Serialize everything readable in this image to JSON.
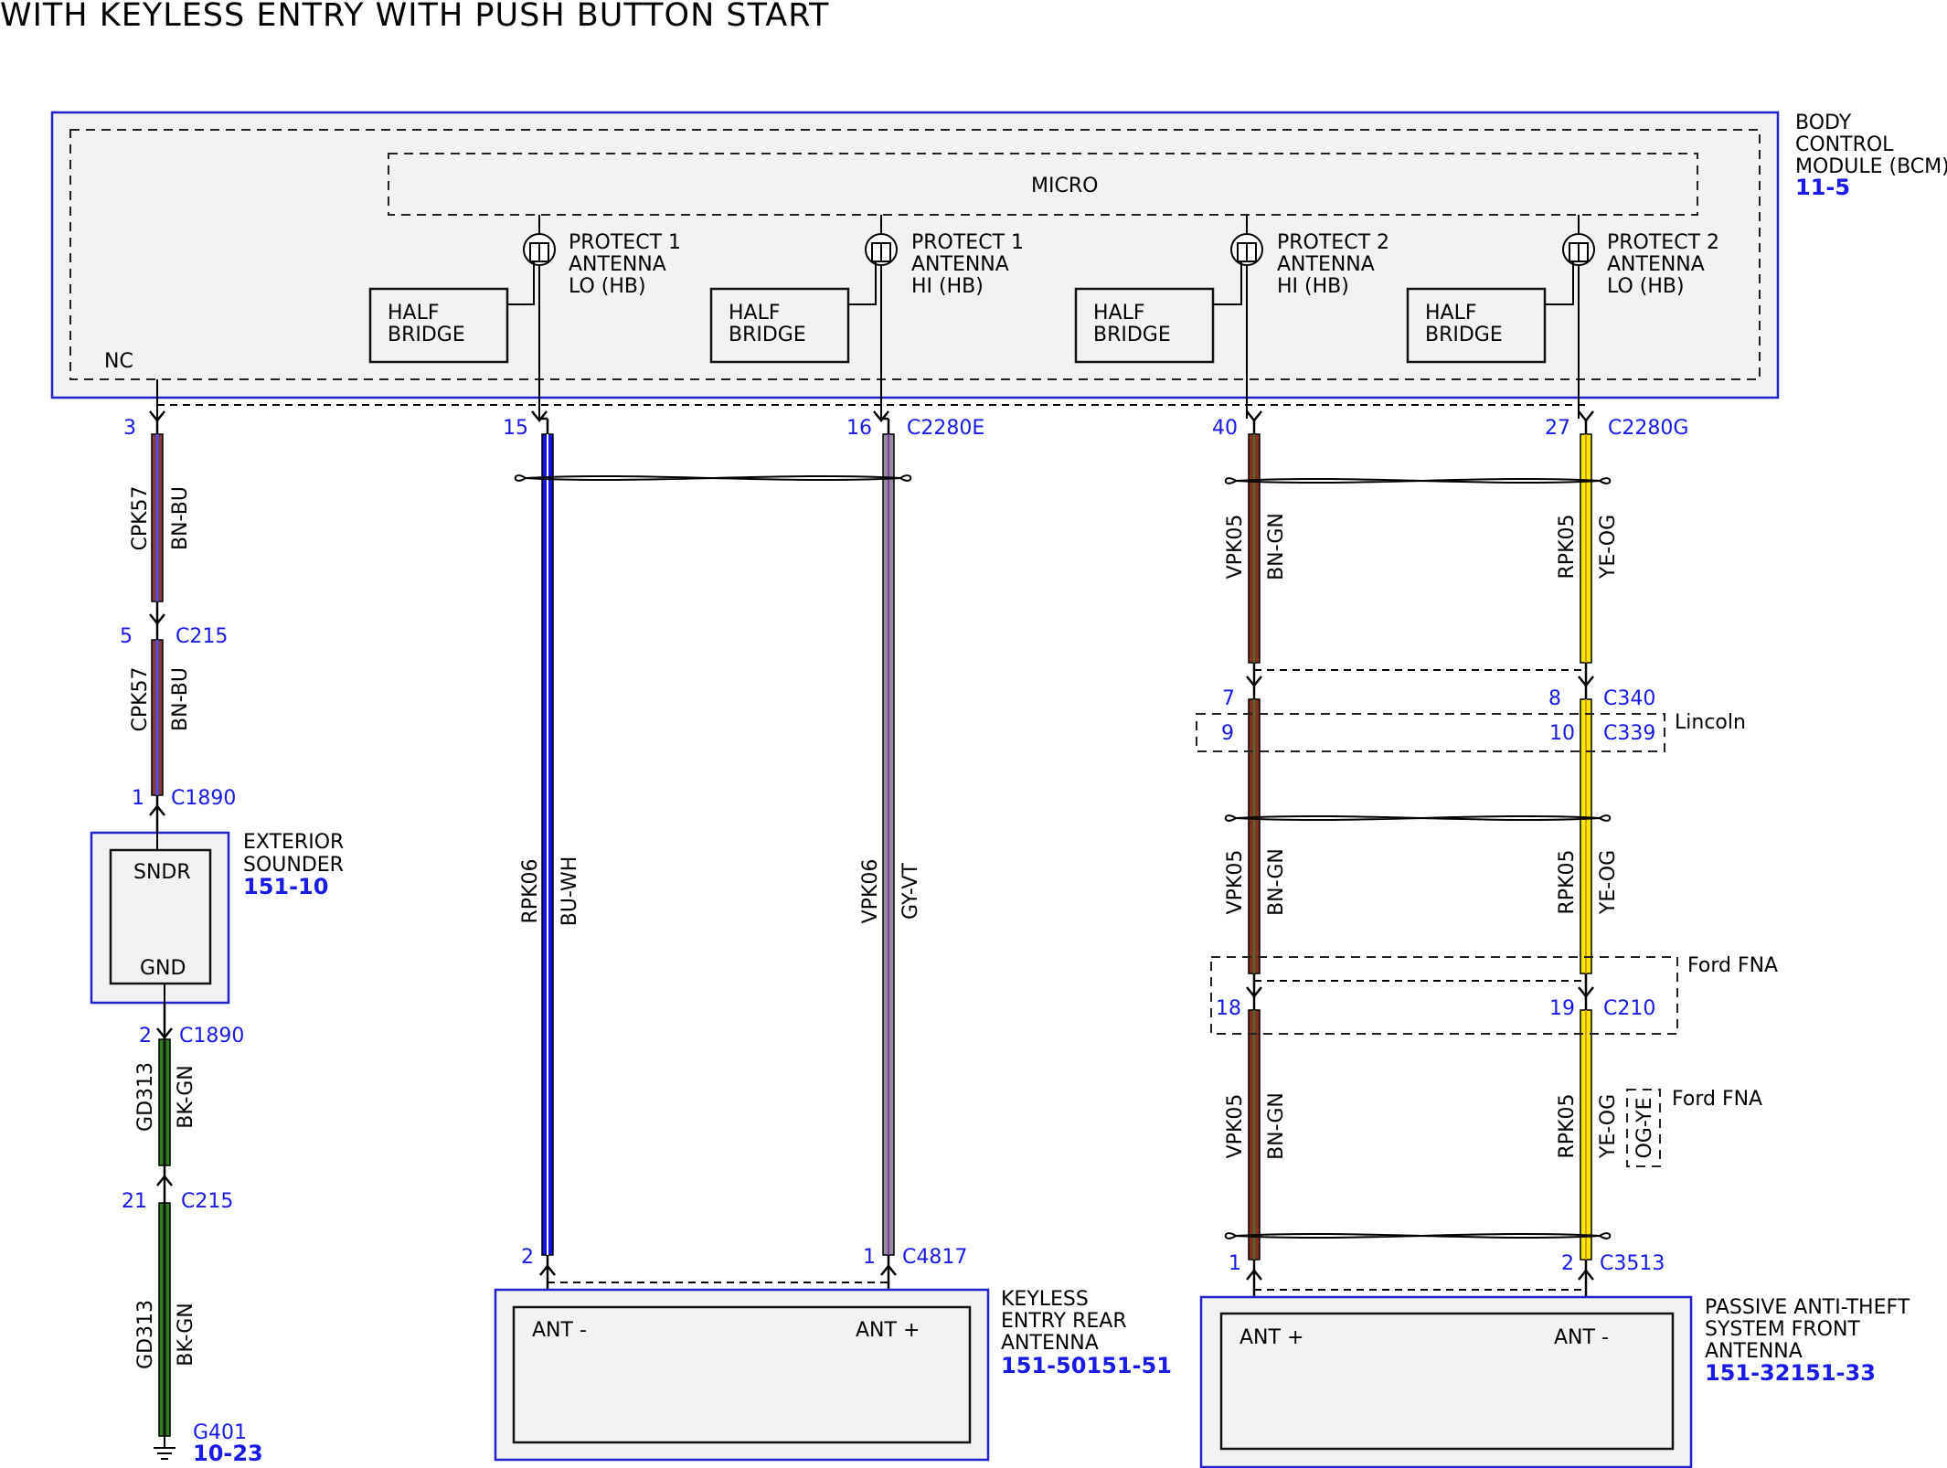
{
  "title": "WITH KEYLESS ENTRY WITH PUSH BUTTON START",
  "bcm": {
    "name": "BODY CONTROL MODULE (BCM)",
    "ref": "11-5",
    "micro": "MICRO",
    "nc": "NC",
    "half_bridge": "HALF BRIDGE",
    "protect_labels": [
      "PROTECT 1 ANTENNA LO (HB)",
      "PROTECT 1 ANTENNA HI (HB)",
      "PROTECT 2 ANTENNA HI (HB)",
      "PROTECT 2 ANTENNA LO (HB)"
    ]
  },
  "connectors": {
    "c2280e": "C2280E",
    "c2280g": "C2280G",
    "c215": "C215",
    "c1890": "C1890",
    "c340": "C340",
    "c339": "C339",
    "c210": "C210",
    "c4817": "C4817",
    "c3513": "C3513"
  },
  "pins": {
    "bcm_3": "3",
    "bcm_15": "15",
    "bcm_16": "16",
    "bcm_40": "40",
    "bcm_27": "27",
    "c215_5": "5",
    "c1890_1": "1",
    "c1890_2": "2",
    "c215_21": "21",
    "c340_7": "7",
    "c340_8": "8",
    "c339_9": "9",
    "c339_10": "10",
    "c210_18": "18",
    "c210_19": "19",
    "c4817_2": "2",
    "c4817_1": "1",
    "c3513_1": "1",
    "c3513_2": "2"
  },
  "circuits": {
    "cpk57": "CPK57",
    "rpk06": "RPK06",
    "vpk06": "VPK06",
    "vpk05": "VPK05",
    "rpk05": "RPK05",
    "gd313": "GD313"
  },
  "wire_colors": {
    "bn_bu": "BN-BU",
    "bu_wh": "BU-WH",
    "gy_vt": "GY-VT",
    "bn_gn": "BN-GN",
    "ye_og": "YE-OG",
    "bk_gn": "BK-GN",
    "og_ye": "OG-YE"
  },
  "exterior_sounder": {
    "name": "EXTERIOR SOUNDER",
    "ref": "151-10",
    "sndr": "SNDR",
    "gnd": "GND"
  },
  "ground": {
    "name": "G401",
    "ref": "10-23"
  },
  "keyless_rear": {
    "name": "KEYLESS ENTRY REAR ANTENNA",
    "ref": "151-50151-51",
    "ant_minus": "ANT -",
    "ant_plus": "ANT +"
  },
  "pats_front": {
    "name": "PASSIVE ANTI-THEFT SYSTEM FRONT ANTENNA",
    "ref": "151-32151-33",
    "ant_plus": "ANT +",
    "ant_minus": "ANT -"
  },
  "variants": {
    "lincoln": "Lincoln",
    "ford_fna": "Ford FNA"
  },
  "colors": {
    "blue_text": "#1a1ae6",
    "bn_bu_wire": "#8b3a3a",
    "bu_wh_wire": "#1414e0",
    "gy_vt_wire": "#9a8aa0",
    "bn_gn_wire": "#8b3020",
    "ye_og_wire": "#f2ea00",
    "bk_gn_wire": "#2f7d1e"
  }
}
